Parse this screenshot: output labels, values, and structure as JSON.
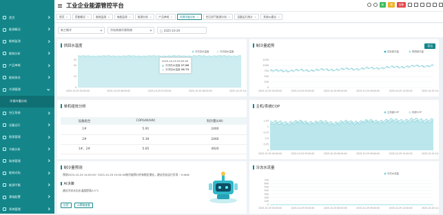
{
  "header": {
    "title": "工业企业能源管控平台",
    "badges": [
      {
        "text": "新",
        "color": "#3dbb5b"
      },
      {
        "text": "预",
        "color": "#f0b429"
      },
      {
        "text": "告警",
        "color": "#e34a4a"
      }
    ]
  },
  "sidebar": {
    "items": [
      {
        "label": "首页"
      },
      {
        "label": "能源概况"
      },
      {
        "label": "能耗监测"
      },
      {
        "label": "能耗分析"
      },
      {
        "label": "产品单耗"
      },
      {
        "label": "能耗排名"
      },
      {
        "label": "冷源管理",
        "open": true,
        "sub": "冷源冷量分析"
      },
      {
        "label": "空压系统"
      },
      {
        "label": "设备运行"
      },
      {
        "label": "报表管理"
      },
      {
        "label": "节能分析"
      },
      {
        "label": "碳排管理"
      },
      {
        "label": "能效对标"
      },
      {
        "label": "能源平衡"
      },
      {
        "label": "基础配置"
      },
      {
        "label": "系统管理"
      }
    ]
  },
  "tabs": [
    {
      "label": "首页"
    },
    {
      "label": "用能概况"
    },
    {
      "label": "能耗监测"
    },
    {
      "label": "电能监测"
    },
    {
      "label": "能源分析"
    },
    {
      "label": "产品单耗"
    },
    {
      "label": "冷源冷量分析",
      "active": true
    },
    {
      "label": "空压机气能源分析"
    },
    {
      "label": "设备运行统计"
    },
    {
      "label": "系统AI建议"
    }
  ],
  "filter": {
    "plant": "有工制冷",
    "system": "冷站系统冷源系统",
    "date": "2025-10-29"
  },
  "cards": {
    "supply": {
      "title": "供回水温度"
    },
    "cold": {
      "title": "制冷量趋势",
      "export": "导出"
    },
    "units": {
      "title": "单机组效分析"
    },
    "cop": {
      "title": "主机/系统COP"
    },
    "forecast": {
      "title": "制冷量预测",
      "text": "预测2025-10-29 14:00:00~2025-10-29 15:00:00制冷量预计约有稳定增长，建议优化运行负荷 ~0.6kW",
      "ai_title": "AI决策",
      "ai_text": "建议冷冻水出水温度提高0.5°C",
      "btn_apply": "应用",
      "btn_view": "AI策略查看"
    },
    "flow": {
      "title": "冷冻水流量"
    }
  },
  "table": {
    "headers": [
      "设备组合",
      "COP(kW/kW)",
      "制冷量(kW)"
    ],
    "rows": [
      [
        "1#",
        "5.91",
        "2460"
      ],
      [
        "2#",
        "5.39",
        "2460"
      ],
      [
        "1#、2#",
        "5.65",
        "4920"
      ]
    ]
  },
  "tooltip": {
    "time": "2025-10-29 05:05:00",
    "rows": [
      {
        "name": "冷冻供水温度",
        "value": "27.88"
      },
      {
        "name": "冷冻回水温度",
        "value": "28.73"
      }
    ]
  },
  "chart_data": [
    {
      "type": "area",
      "title": "供回水温度",
      "x": [
        "2025-10-29 00:00:00",
        "2025-10-29 06:00:00",
        "2025-10-29 07:00:00",
        "2025-10-29 08:00:00",
        "2025-10-29 14:00:00"
      ],
      "ylim": [
        0,
        30
      ],
      "yticks": [
        0,
        10,
        20,
        25
      ],
      "series": [
        {
          "name": "冷冻供水温度",
          "values": [
            27.8,
            27.9,
            27.88,
            27.9,
            27.9
          ]
        },
        {
          "name": "冷冻回水温度",
          "values": [
            28.7,
            28.7,
            28.73,
            28.8,
            28.8
          ]
        }
      ]
    },
    {
      "type": "line",
      "title": "制冷量趋势",
      "x": [
        "2025-10-29 00:00:00",
        "2025-10-29 03:00:00",
        "2025-10-29 06:00:00",
        "2025-10-29 09:00:00",
        "2025-10-29 12:00:00",
        "2025-10-29 14:00:00"
      ],
      "ylim": [
        0,
        1500
      ],
      "yticks": [
        0,
        250,
        500,
        750,
        1000,
        1250
      ],
      "series": [
        {
          "name": "实际制冷量",
          "values": [
            760,
            780,
            820,
            870,
            940,
            1000
          ]
        },
        {
          "name": "预测制冷量",
          "values": [
            720,
            760,
            800,
            850,
            920,
            990
          ]
        }
      ]
    },
    {
      "type": "area",
      "title": "主机/系统COP",
      "x": [
        "2025-10-29 00:00:00",
        "2025-10-29 03:00:00",
        "2025-10-29 06:00:00",
        "2025-10-29 09:00:00",
        "2025-10-29 12:00:00",
        "2025-10-29 14:00:00"
      ],
      "ylim": [
        0,
        1.5
      ],
      "yticks": [
        0,
        0.25,
        0.5,
        0.75,
        1,
        1.25
      ],
      "series": [
        {
          "name": "主机组COP",
          "values": [
            1.1,
            1.15,
            1.12,
            1.18,
            1.2,
            1.22
          ]
        },
        {
          "name": "系统COP",
          "values": [
            1.2,
            1.22,
            1.2,
            1.25,
            1.3,
            1.32
          ]
        }
      ]
    },
    {
      "type": "line",
      "title": "冷冻水流量",
      "x": [
        "2025-10-29 00:00:00",
        "2025-10-29 03:00:00",
        "2025-10-29 06:00:00",
        "2025-10-29 09:00:00",
        "2025-10-29 12:00:00",
        "2025-10-29 14:00:00"
      ],
      "ylim": [
        0,
        800
      ],
      "yticks": [
        0,
        100,
        200,
        300,
        400,
        500,
        600,
        700
      ],
      "series": [
        {
          "name": "冷冻水流量",
          "values": [
            0,
            0,
            0,
            0,
            0,
            0
          ]
        }
      ]
    }
  ]
}
